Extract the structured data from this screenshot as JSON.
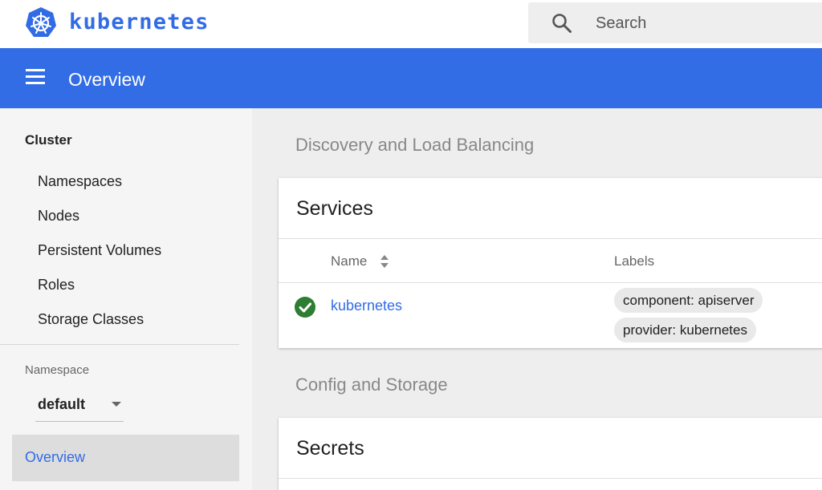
{
  "app": {
    "brand": "kubernetes"
  },
  "search": {
    "placeholder": "Search",
    "value": ""
  },
  "header": {
    "title": "Overview"
  },
  "sidebar": {
    "cluster_heading": "Cluster",
    "cluster_items": [
      "Namespaces",
      "Nodes",
      "Persistent Volumes",
      "Roles",
      "Storage Classes"
    ],
    "namespace_label": "Namespace",
    "namespace_value": "default",
    "active_item": "Overview"
  },
  "main": {
    "sections": [
      {
        "title": "Discovery and Load Balancing",
        "card": {
          "title": "Services",
          "columns": [
            "Name",
            "Labels"
          ],
          "rows": [
            {
              "status": "ok",
              "name": "kubernetes",
              "labels": [
                "component: apiserver",
                "provider: kubernetes"
              ]
            }
          ]
        }
      },
      {
        "title": "Config and Storage",
        "card": {
          "title": "Secrets"
        }
      }
    ]
  },
  "colors": {
    "accent": "#326ce5",
    "header_bg": "#326de6",
    "status_ok": "#2e7d32"
  },
  "icons": [
    "kubernetes-logo-icon",
    "search-icon",
    "menu-icon",
    "sort-icon",
    "check-circle-icon",
    "chevron-down-icon"
  ]
}
